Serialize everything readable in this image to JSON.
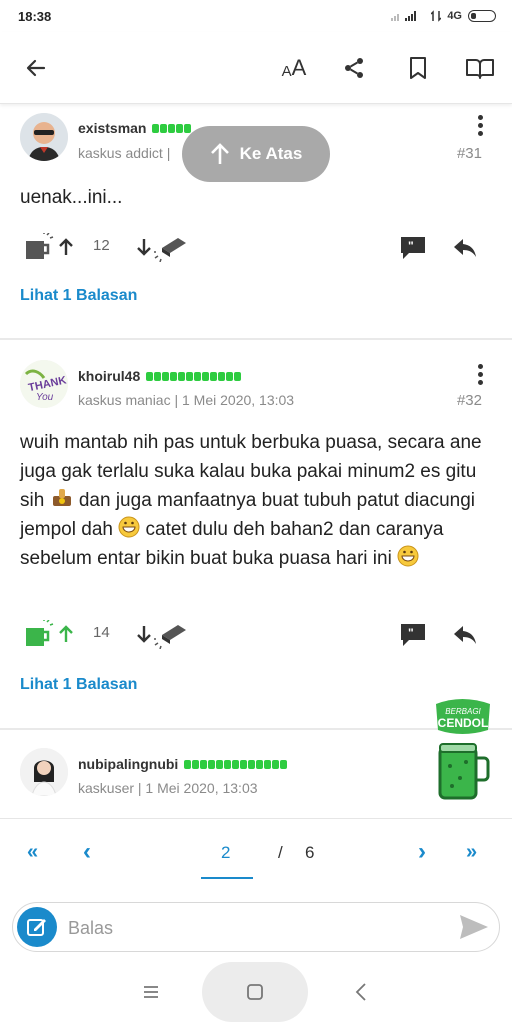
{
  "status": {
    "time": "18:38",
    "network": "4G"
  },
  "header": {
    "back_icon": "arrow-left-icon",
    "font_size_label": "A",
    "font_size_label_big": "A",
    "share_icon": "share-icon",
    "bookmark_icon": "bookmark-icon",
    "read_icon": "open-book-icon"
  },
  "ke_atas": {
    "label": "Ke Atas"
  },
  "posts": [
    {
      "username": "existsman",
      "rank": "kaskus addict",
      "number": "#31",
      "body": "uenak...ini...",
      "upvotes": "12",
      "replies_link": "Lihat 1 Balasan"
    },
    {
      "username": "khoirul48",
      "rank_time": "kaskus maniac | 1 Mei 2020, 13:03",
      "number": "#32",
      "body_1": "wuih mantab nih pas untuk berbuka puasa, secara ane juga gak terlalu suka kalau buka pakai minum2 es gitu sih ",
      "body_2": " dan juga manfaatnya buat tubuh patut diacungi jempol dah ",
      "body_3": " catet dulu deh bahan2 dan caranya sebelum entar bikin buat buka puasa hari ini ",
      "upvotes": "14",
      "replies_link": "Lihat 1 Balasan"
    },
    {
      "username": "nubipalingnubi",
      "rank_time": "kaskuser | 1 Mei 2020, 13:03"
    }
  ],
  "avatar_text": {
    "thank": "THANK",
    "you": "You"
  },
  "cendol_badge": {
    "line1": "BERBAGI",
    "line2": "CENDOL"
  },
  "pagination": {
    "first": "«",
    "prev": "‹",
    "current": "2",
    "separator": "/",
    "total": "6",
    "next": "›",
    "last": "»"
  },
  "reply": {
    "placeholder": "Balas"
  },
  "colors": {
    "accent": "#1a8acb",
    "rep_green": "#2ecc40",
    "cendol_green": "#3bb54a"
  }
}
